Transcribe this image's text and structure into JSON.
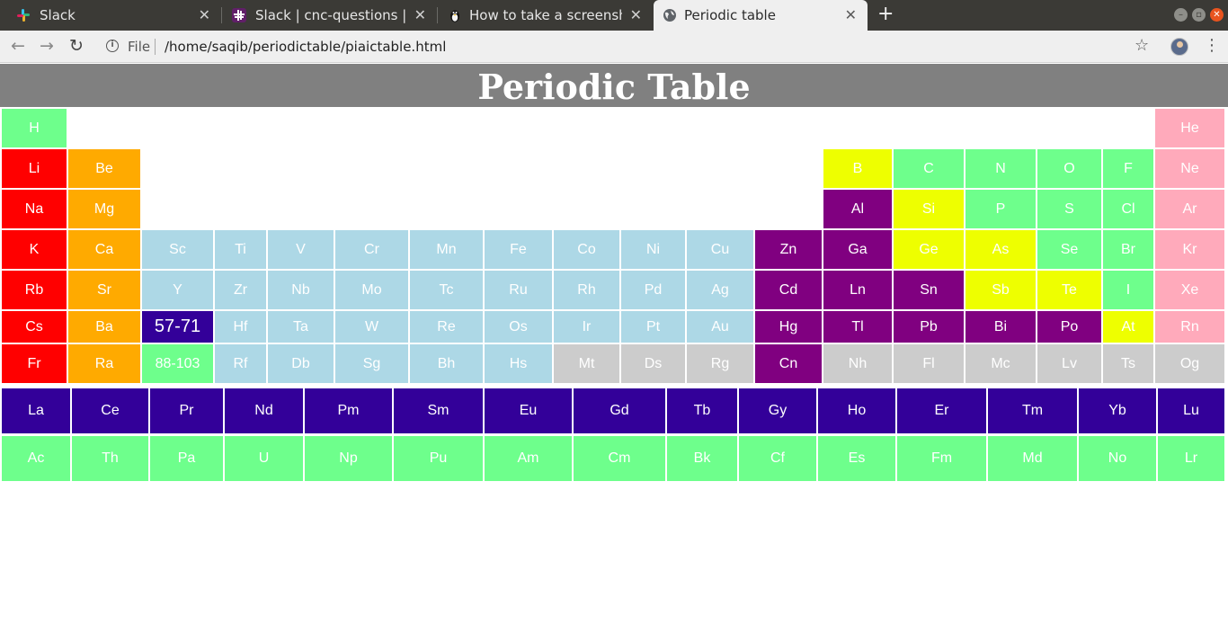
{
  "browser": {
    "tabs": [
      {
        "title": "Slack",
        "icon": "slack-icon"
      },
      {
        "title": "Slack | cnc-questions | PIAIC",
        "icon": "slack-icon"
      },
      {
        "title": "How to take a screenshot",
        "icon": "linux-tux-icon"
      },
      {
        "title": "Periodic table",
        "icon": "globe-icon",
        "active": true
      }
    ],
    "new_tab": "+",
    "scheme": "File",
    "url": "/home/saqib/periodictable/piaictable.html"
  },
  "page": {
    "title": "Periodic Table"
  },
  "colors": {
    "alkali": "#ff0000",
    "alkaline": "#ffaa00",
    "transition": "#add8e6",
    "post_transition": "#800080",
    "metalloid": "#eeff00",
    "nonmetal": "#6eff8c",
    "noble": "#ffaabb",
    "unknown": "#cccccc",
    "series": "#330099"
  },
  "table": {
    "rows": [
      [
        "H",
        "He"
      ],
      [
        "Li",
        "Be",
        "B",
        "C",
        "N",
        "O",
        "F",
        "Ne"
      ],
      [
        "Na",
        "Mg",
        "Al",
        "Si",
        "P",
        "S",
        "Cl",
        "Ar"
      ],
      [
        "K",
        "Ca",
        "Sc",
        "Ti",
        "V",
        "Cr",
        "Mn",
        "Fe",
        "Co",
        "Ni",
        "Cu",
        "Zn",
        "Ga",
        "Ge",
        "As",
        "Se",
        "Br",
        "Kr"
      ],
      [
        "Rb",
        "Sr",
        "Y",
        "Zr",
        "Nb",
        "Mo",
        "Tc",
        "Ru",
        "Rh",
        "Pd",
        "Ag",
        "Cd",
        "Ln",
        "Sn",
        "Sb",
        "Te",
        "I",
        "Xe"
      ],
      [
        "Cs",
        "Ba",
        "57-71",
        "Hf",
        "Ta",
        "W",
        "Re",
        "Os",
        "Ir",
        "Pt",
        "Au",
        "Hg",
        "Tl",
        "Pb",
        "Bi",
        "Po",
        "At",
        "Rn"
      ],
      [
        "Fr",
        "Ra",
        "88-103",
        "Rf",
        "Db",
        "Sg",
        "Bh",
        "Hs",
        "Mt",
        "Ds",
        "Rg",
        "Cn",
        "Nh",
        "Fl",
        "Mc",
        "Lv",
        "Ts",
        "Og"
      ]
    ],
    "categories": [
      [
        "nonmetal",
        "noble"
      ],
      [
        "alkali",
        "alkaline",
        "metalloid",
        "nonmetal",
        "nonmetal",
        "nonmetal",
        "nonmetal",
        "noble"
      ],
      [
        "alkali",
        "alkaline",
        "post_transition",
        "metalloid",
        "nonmetal",
        "nonmetal",
        "nonmetal",
        "noble"
      ],
      [
        "alkali",
        "alkaline",
        "transition",
        "transition",
        "transition",
        "transition",
        "transition",
        "transition",
        "transition",
        "transition",
        "transition",
        "post_transition",
        "post_transition",
        "metalloid",
        "metalloid",
        "nonmetal",
        "nonmetal",
        "noble"
      ],
      [
        "alkali",
        "alkaline",
        "transition",
        "transition",
        "transition",
        "transition",
        "transition",
        "transition",
        "transition",
        "transition",
        "transition",
        "post_transition",
        "post_transition",
        "post_transition",
        "metalloid",
        "metalloid",
        "nonmetal",
        "noble"
      ],
      [
        "alkali",
        "alkaline",
        "series",
        "transition",
        "transition",
        "transition",
        "transition",
        "transition",
        "transition",
        "transition",
        "transition",
        "post_transition",
        "post_transition",
        "post_transition",
        "post_transition",
        "post_transition",
        "metalloid",
        "noble"
      ],
      [
        "alkali",
        "alkaline",
        "nonmetal",
        "transition",
        "transition",
        "transition",
        "transition",
        "transition",
        "unknown",
        "unknown",
        "unknown",
        "post_transition",
        "unknown",
        "unknown",
        "unknown",
        "unknown",
        "unknown",
        "unknown"
      ]
    ]
  },
  "lanthanides": [
    "La",
    "Ce",
    "Pr",
    "Nd",
    "Pm",
    "Sm",
    "Eu",
    "Gd",
    "Tb",
    "Gy",
    "Ho",
    "Er",
    "Tm",
    "Yb",
    "Lu"
  ],
  "actinides": [
    "Ac",
    "Th",
    "Pa",
    "U",
    "Np",
    "Pu",
    "Am",
    "Cm",
    "Bk",
    "Cf",
    "Es",
    "Fm",
    "Md",
    "No",
    "Lr"
  ]
}
